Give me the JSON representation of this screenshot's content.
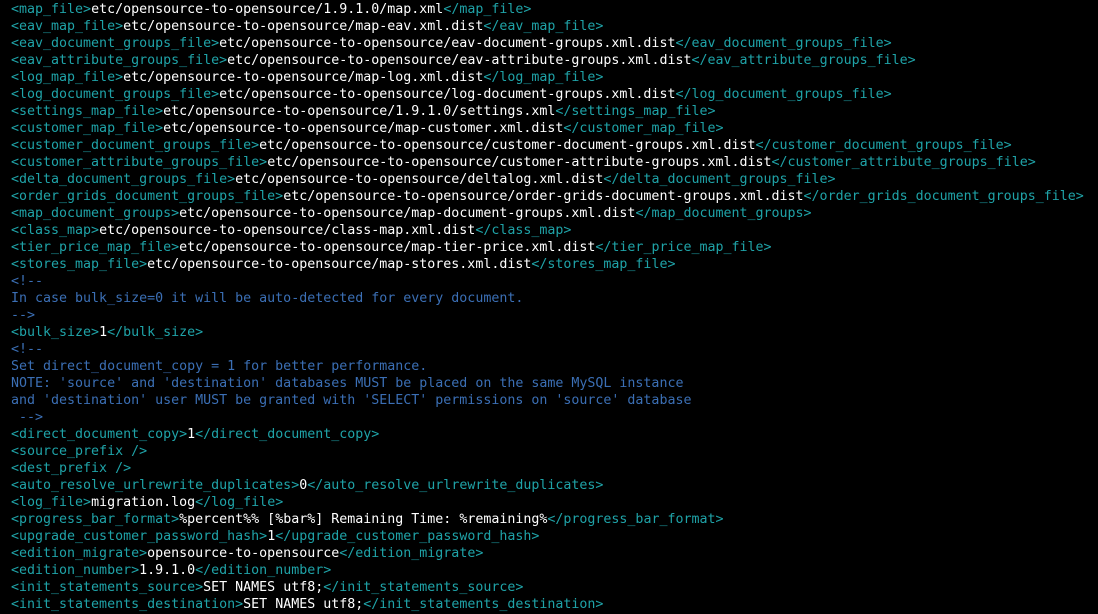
{
  "colors": {
    "background": "#000000",
    "tag": "#1fa3a8",
    "value": "#ffffff",
    "comment": "#3b6fb5"
  },
  "lines": [
    {
      "kind": "elem",
      "open": "<map_file>",
      "value": "etc/opensource-to-opensource/1.9.1.0/map.xml",
      "close": "</map_file>"
    },
    {
      "kind": "elem",
      "open": "<eav_map_file>",
      "value": "etc/opensource-to-opensource/map-eav.xml.dist",
      "close": "</eav_map_file>"
    },
    {
      "kind": "elem",
      "open": "<eav_document_groups_file>",
      "value": "etc/opensource-to-opensource/eav-document-groups.xml.dist",
      "close": "</eav_document_groups_file>"
    },
    {
      "kind": "elem",
      "open": "<eav_attribute_groups_file>",
      "value": "etc/opensource-to-opensource/eav-attribute-groups.xml.dist",
      "close": "</eav_attribute_groups_file>"
    },
    {
      "kind": "elem",
      "open": "<log_map_file>",
      "value": "etc/opensource-to-opensource/map-log.xml.dist",
      "close": "</log_map_file>"
    },
    {
      "kind": "elem",
      "open": "<log_document_groups_file>",
      "value": "etc/opensource-to-opensource/log-document-groups.xml.dist",
      "close": "</log_document_groups_file>"
    },
    {
      "kind": "elem",
      "open": "<settings_map_file>",
      "value": "etc/opensource-to-opensource/1.9.1.0/settings.xml",
      "close": "</settings_map_file>"
    },
    {
      "kind": "elem",
      "open": "<customer_map_file>",
      "value": "etc/opensource-to-opensource/map-customer.xml.dist",
      "close": "</customer_map_file>"
    },
    {
      "kind": "elem",
      "open": "<customer_document_groups_file>",
      "value": "etc/opensource-to-opensource/customer-document-groups.xml.dist",
      "close": "</customer_document_groups_file>"
    },
    {
      "kind": "elem",
      "open": "<customer_attribute_groups_file>",
      "value": "etc/opensource-to-opensource/customer-attribute-groups.xml.dist",
      "close": "</customer_attribute_groups_file>"
    },
    {
      "kind": "elem",
      "open": "<delta_document_groups_file>",
      "value": "etc/opensource-to-opensource/deltalog.xml.dist",
      "close": "</delta_document_groups_file>"
    },
    {
      "kind": "elem",
      "open": "<order_grids_document_groups_file>",
      "value": "etc/opensource-to-opensource/order-grids-document-groups.xml.dist",
      "close": "</order_grids_document_groups_file>"
    },
    {
      "kind": "elem",
      "open": "<map_document_groups>",
      "value": "etc/opensource-to-opensource/map-document-groups.xml.dist",
      "close": "</map_document_groups>"
    },
    {
      "kind": "elem",
      "open": "<class_map>",
      "value": "etc/opensource-to-opensource/class-map.xml.dist",
      "close": "</class_map>"
    },
    {
      "kind": "elem",
      "open": "<tier_price_map_file>",
      "value": "etc/opensource-to-opensource/map-tier-price.xml.dist",
      "close": "</tier_price_map_file>"
    },
    {
      "kind": "elem",
      "open": "<stores_map_file>",
      "value": "etc/opensource-to-opensource/map-stores.xml.dist",
      "close": "</stores_map_file>"
    },
    {
      "kind": "comment",
      "text": "<!--"
    },
    {
      "kind": "comment",
      "text": "In case bulk_size=0 it will be auto-detected for every document."
    },
    {
      "kind": "comment",
      "text": "-->"
    },
    {
      "kind": "elem",
      "open": "<bulk_size>",
      "value": "1",
      "close": "</bulk_size>"
    },
    {
      "kind": "comment",
      "text": "<!--"
    },
    {
      "kind": "comment",
      "text": "Set direct_document_copy = 1 for better performance."
    },
    {
      "kind": "comment",
      "text": "NOTE: 'source' and 'destination' databases MUST be placed on the same MySQL instance"
    },
    {
      "kind": "comment",
      "text": "and 'destination' user MUST be granted with 'SELECT' permissions on 'source' database"
    },
    {
      "kind": "comment",
      "text": " -->"
    },
    {
      "kind": "elem",
      "open": "<direct_document_copy>",
      "value": "1",
      "close": "</direct_document_copy>"
    },
    {
      "kind": "empty",
      "open": "<source_prefix />"
    },
    {
      "kind": "empty",
      "open": "<dest_prefix />"
    },
    {
      "kind": "elem",
      "open": "<auto_resolve_urlrewrite_duplicates>",
      "value": "0",
      "close": "</auto_resolve_urlrewrite_duplicates>"
    },
    {
      "kind": "elem",
      "open": "<log_file>",
      "value": "migration.log",
      "close": "</log_file>"
    },
    {
      "kind": "elem",
      "open": "<progress_bar_format>",
      "value": "%percent%% [%bar%] Remaining Time: %remaining%",
      "close": "</progress_bar_format>"
    },
    {
      "kind": "elem",
      "open": "<upgrade_customer_password_hash>",
      "value": "1",
      "close": "</upgrade_customer_password_hash>"
    },
    {
      "kind": "elem",
      "open": "<edition_migrate>",
      "value": "opensource-to-opensource",
      "close": "</edition_migrate>"
    },
    {
      "kind": "elem",
      "open": "<edition_number>",
      "value": "1.9.1.0",
      "close": "</edition_number>"
    },
    {
      "kind": "elem",
      "open": "<init_statements_source>",
      "value": "SET NAMES utf8;",
      "close": "</init_statements_source>"
    },
    {
      "kind": "elem",
      "open": "<init_statements_destination>",
      "value": "SET NAMES utf8;",
      "close": "</init_statements_destination>"
    }
  ]
}
